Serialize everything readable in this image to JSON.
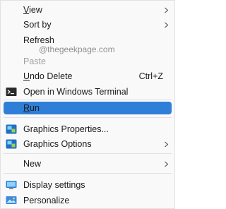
{
  "menu": {
    "items": {
      "view": {
        "label": "View",
        "has_submenu": true
      },
      "sort_by": {
        "label": "Sort by",
        "has_submenu": true
      },
      "refresh": {
        "label": "Refresh"
      },
      "paste": {
        "label": "Paste",
        "disabled": true
      },
      "undo_delete": {
        "label": "Undo Delete",
        "shortcut": "Ctrl+Z"
      },
      "open_terminal": {
        "label": "Open in Windows Terminal",
        "icon": "terminal-icon"
      },
      "run": {
        "label": "Run",
        "highlighted": true
      },
      "graphics_properties": {
        "label": "Graphics Properties...",
        "icon": "intel-graphics-icon"
      },
      "graphics_options": {
        "label": "Graphics Options",
        "icon": "intel-graphics-icon",
        "has_submenu": true
      },
      "new": {
        "label": "New",
        "has_submenu": true
      },
      "display_settings": {
        "label": "Display settings",
        "icon": "display-icon"
      },
      "personalize": {
        "label": "Personalize",
        "icon": "personalize-icon"
      }
    }
  },
  "watermark": "@thegeekpage.com",
  "colors": {
    "highlight": "#2f7fd8",
    "menu_background": "#f9f9f9",
    "disabled_text": "#a0a0a0"
  }
}
